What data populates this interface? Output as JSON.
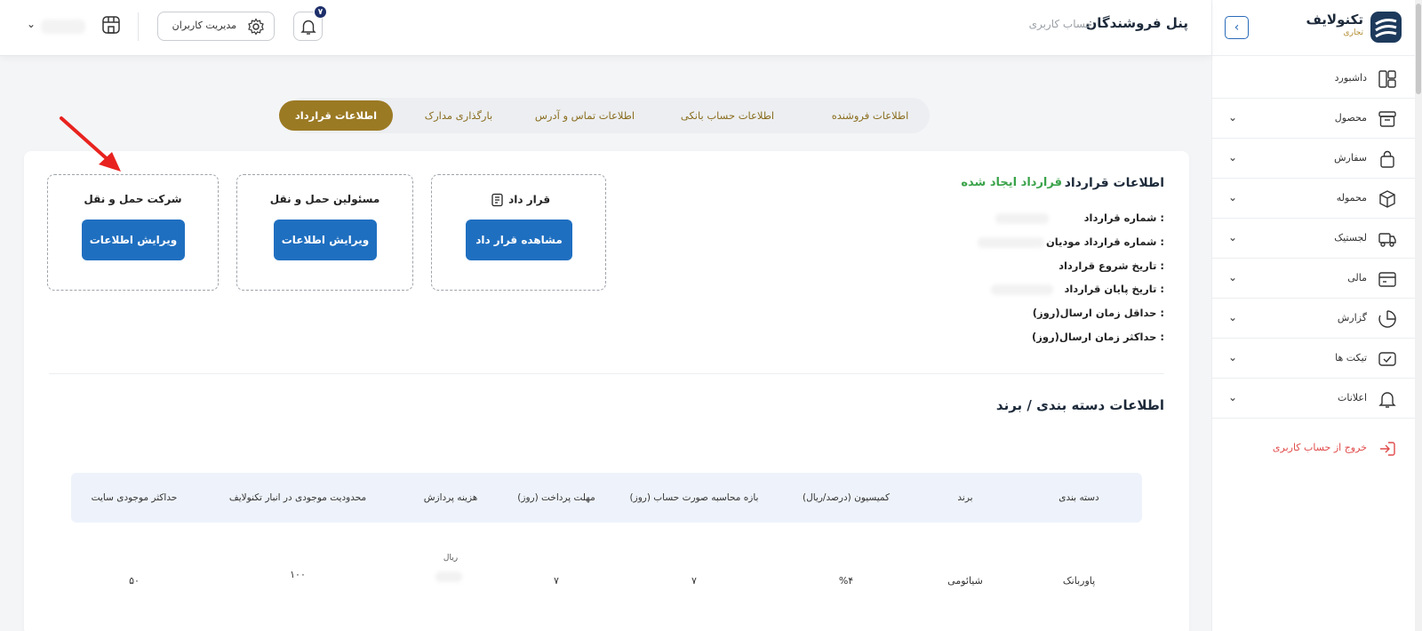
{
  "brand": {
    "name": "تکنولایف",
    "sub": "تجاری"
  },
  "header": {
    "title": "پنل فروشندگان",
    "subtitle": "حساب کاربری",
    "users_button": "مدیریت کاربران",
    "notification_count": "۷"
  },
  "sidebar": {
    "items": [
      {
        "label": "داشبورد",
        "icon": "dashboard-icon",
        "has_submenu": false
      },
      {
        "label": "محصول",
        "icon": "box-icon",
        "has_submenu": true
      },
      {
        "label": "سفارش",
        "icon": "bag-icon",
        "has_submenu": true
      },
      {
        "label": "محموله",
        "icon": "package-icon",
        "has_submenu": true
      },
      {
        "label": "لجستیک",
        "icon": "truck-icon",
        "has_submenu": true
      },
      {
        "label": "مالی",
        "icon": "wallet-icon",
        "has_submenu": true
      },
      {
        "label": "گزارش",
        "icon": "chart-icon",
        "has_submenu": true
      },
      {
        "label": "تیکت ها",
        "icon": "ticket-icon",
        "has_submenu": true
      },
      {
        "label": "اعلانات",
        "icon": "bell-icon",
        "has_submenu": true
      }
    ],
    "logout": "خروج از حساب کاربری"
  },
  "tabs": [
    "اطلاعات فروشنده",
    "اطلاعات حساب بانکی",
    "اطلاعات تماس و آدرس",
    "بارگذاری مدارک",
    "اطلاعات قرارداد"
  ],
  "active_tab": "اطلاعات قرارداد",
  "contract": {
    "title": "اطلاعات قرارداد",
    "status": "قرارداد ایجاد شده",
    "fields": [
      "شماره قرارداد :",
      "شماره قرارداد مودیان :",
      "تاریخ شروع قرارداد :",
      "تاریخ پایان قرارداد :",
      "حداقل زمان ارسال(روز) :",
      "حداکثر زمان ارسال(روز) :"
    ]
  },
  "boxes": {
    "contract": {
      "title": "قرار داد",
      "button": "مشاهده قرار داد"
    },
    "transport_officials": {
      "title": "مسئولین حمل و نقل",
      "button": "ویرایش اطلاعات"
    },
    "transport_company": {
      "title": "شرکت حمل و نقل",
      "button": "ویرایش اطلاعات"
    }
  },
  "category": {
    "title": "اطلاعات دسته بندی / برند",
    "columns": [
      "دسته بندی",
      "برند",
      "کمیسیون (درصد/ریال)",
      "بازه محاسبه صورت حساب (روز)",
      "مهلت پرداخت (روز)",
      "هزینه پردازش",
      "محدودیت موجودی در انبار تکنولایف",
      "حداکثر موجودی سایت"
    ],
    "rows": [
      {
        "category": "پاوربانک",
        "brand": "شیائومی",
        "commission": "%۴",
        "billing_period": "۷",
        "payment_deadline": "۷",
        "processing_fee_unit": "ریال",
        "stock_limit": "۱۰۰",
        "max_site_stock": "۵۰"
      }
    ]
  },
  "colors": {
    "primary": "#1f6fc0",
    "gold": "#9b7a24",
    "success": "#3aa34a",
    "danger": "#e04a4a"
  }
}
